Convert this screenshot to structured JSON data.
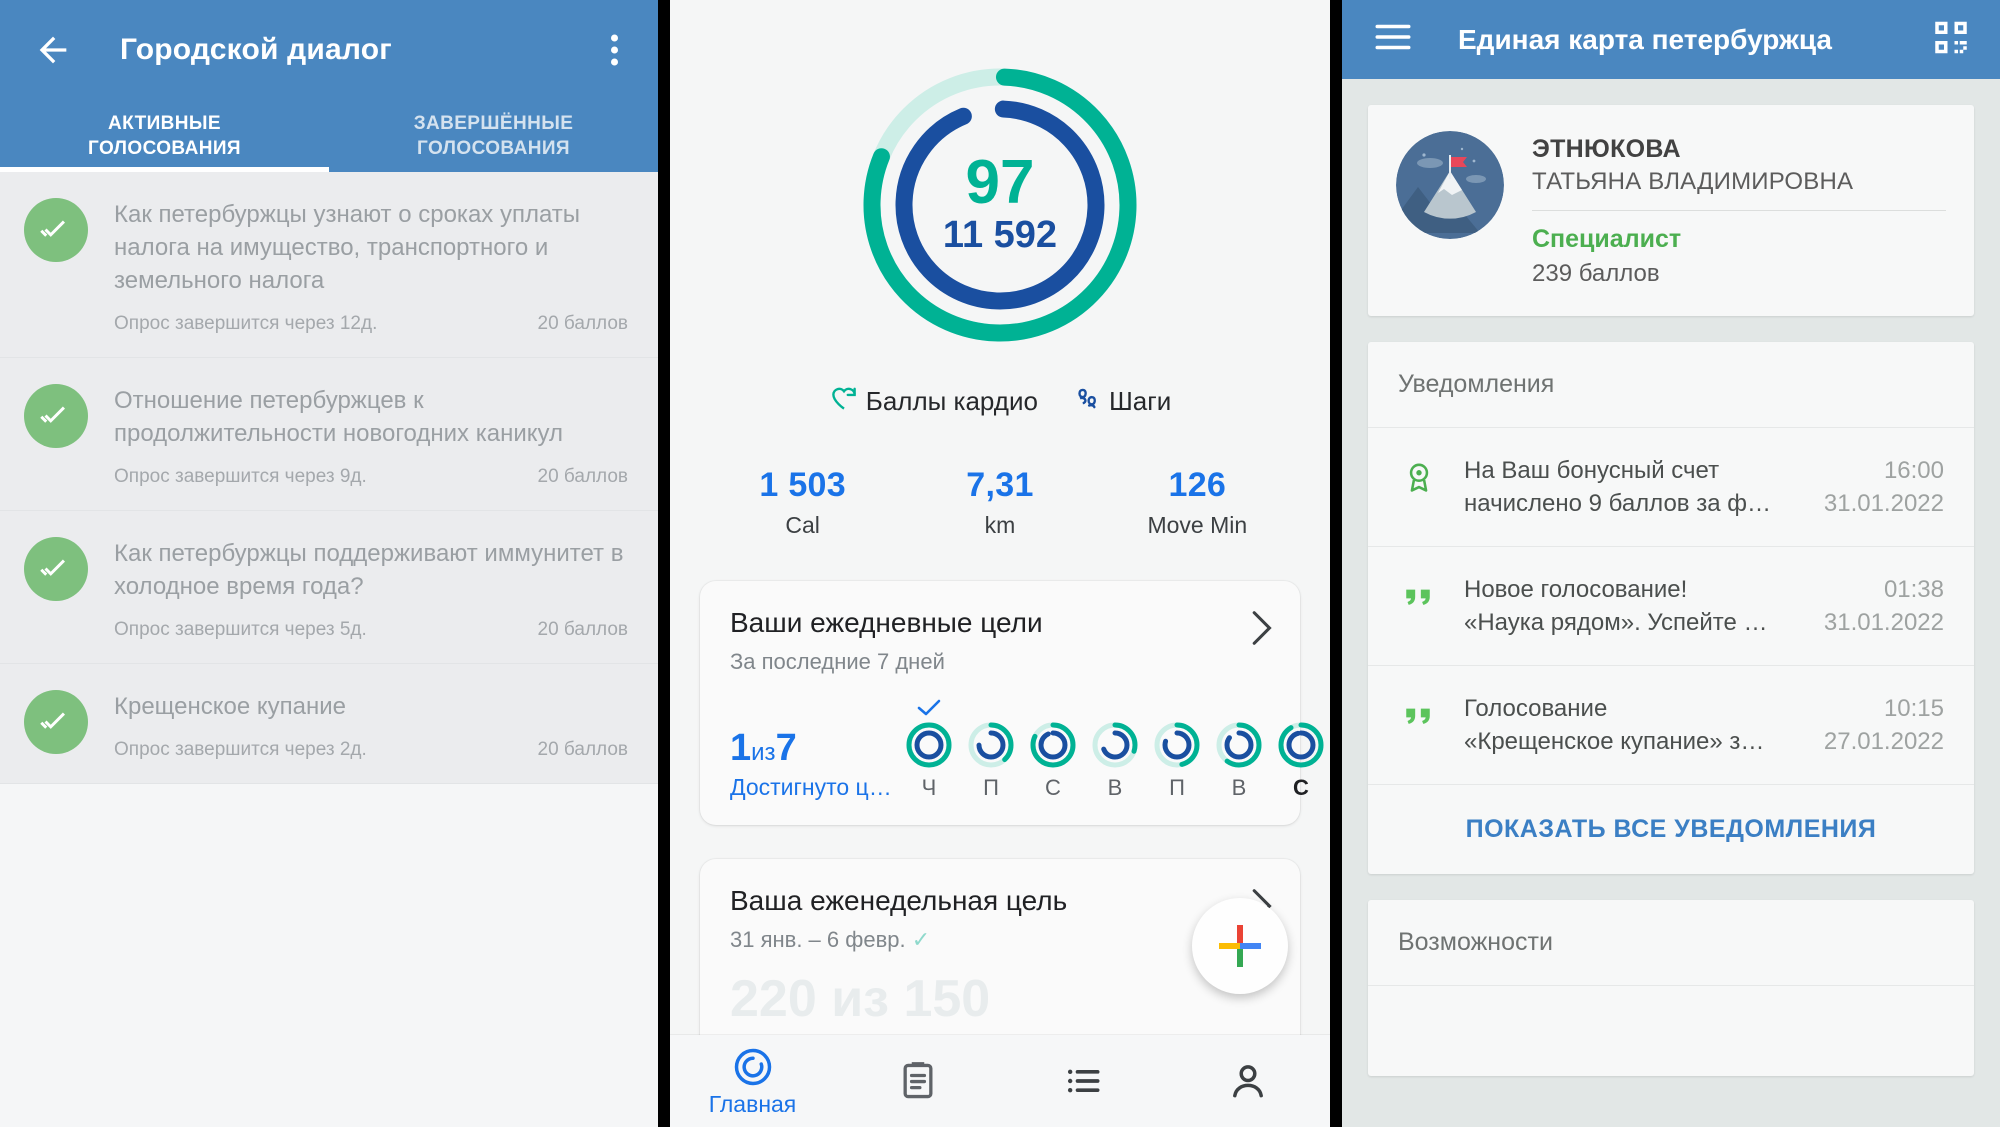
{
  "votes_app": {
    "appbar": {
      "title": "Городской диалог",
      "back_icon": "back-arrow-icon",
      "menu_icon": "kebab-menu-icon"
    },
    "tabs": [
      {
        "line1": "АКТИВНЫЕ",
        "line2": "ГОЛОСОВАНИЯ",
        "active": true
      },
      {
        "line1": "ЗАВЕРШЁННЫЕ",
        "line2": "ГОЛОСОВАНИЯ",
        "active": false
      }
    ],
    "items": [
      {
        "question": "Как петербуржцы узнают о сроках уплаты налога на имущество, транспортного и земельного налога",
        "deadline": "Опрос завершится через 12д.",
        "points": "20 баллов",
        "icon": "double-check-icon"
      },
      {
        "question": "Отношение петербуржцев к продолжительности новогодних каникул",
        "deadline": "Опрос завершится через 9д.",
        "points": "20 баллов",
        "icon": "double-check-icon"
      },
      {
        "question": "Как петербуржцы поддерживают иммунитет в холодное время года?",
        "deadline": "Опрос завершится через 5д.",
        "points": "20 баллов",
        "icon": "double-check-icon"
      },
      {
        "question": "Крещенское купание",
        "deadline": "Опрос завершится через 2д.",
        "points": "20 баллов",
        "icon": "double-check-icon"
      }
    ],
    "colors": {
      "appbar": "#4a87c0",
      "check_circle": "#7ec07e",
      "list_bg": "#ebecee"
    }
  },
  "fit_app": {
    "rings": {
      "heart_points_value": "97",
      "steps_value": "11 592",
      "heart_points_color": "#00b294",
      "steps_color": "#1a4fa0"
    },
    "legend": [
      {
        "label": "Баллы кардио",
        "icon": "heart-points-icon",
        "color": "#00b294"
      },
      {
        "label": "Шаги",
        "icon": "steps-icon",
        "color": "#1a4fa0"
      }
    ],
    "stats": [
      {
        "value": "1 503",
        "label": "Cal"
      },
      {
        "value": "7,31",
        "label": "km"
      },
      {
        "value": "126",
        "label": "Move Min"
      }
    ],
    "daily_card": {
      "title": "Ваши ежедневные цели",
      "subtitle": "За последние 7 дней",
      "count_num": "1",
      "count_mid": "из",
      "count_total": "7",
      "count_label": "Достигнуто ц…",
      "chevron": "chevron-right-icon",
      "days": [
        {
          "label": "Ч",
          "achieved": true,
          "ring_pct": 100,
          "bold": false
        },
        {
          "label": "П",
          "achieved": false,
          "ring_pct": 38,
          "bold": false
        },
        {
          "label": "С",
          "achieved": false,
          "ring_pct": 82,
          "bold": false
        },
        {
          "label": "В",
          "achieved": false,
          "ring_pct": 30,
          "bold": false
        },
        {
          "label": "П",
          "achieved": false,
          "ring_pct": 46,
          "bold": false
        },
        {
          "label": "В",
          "achieved": false,
          "ring_pct": 60,
          "bold": false
        },
        {
          "label": "С",
          "achieved": false,
          "ring_pct": 92,
          "bold": true
        }
      ]
    },
    "weekly_card": {
      "title": "Ваша еженедельная цель",
      "range": "31 янв. – 6 февр.",
      "progress": "220 из 150",
      "chevron": "chevron-right-icon"
    },
    "fab": {
      "icon": "google-plus-add-icon"
    },
    "bottom_nav": [
      {
        "label": "Главная",
        "icon": "activity-ring-icon",
        "active": true
      },
      {
        "label": "",
        "icon": "journal-icon",
        "active": false
      },
      {
        "label": "",
        "icon": "list-icon",
        "active": false
      },
      {
        "label": "",
        "icon": "profile-icon",
        "active": false
      }
    ],
    "colors": {
      "accent_blue": "#1a73e8",
      "teal": "#00b294",
      "navy": "#1a4fa0"
    }
  },
  "ekp_app": {
    "appbar": {
      "title": "Единая карта петербуржца",
      "menu_icon": "hamburger-menu-icon",
      "qr_icon": "qr-code-icon"
    },
    "profile": {
      "surname": "ЭТНЮКОВА",
      "given_name": "ТАТЬЯНА ВЛАДИМИРОВНА",
      "rank": "Специалист",
      "points": "239 баллов",
      "avatar_icon": "mountain-flag-avatar"
    },
    "notifications_header": "Уведомления",
    "notifications": [
      {
        "line1": "На Ваш бонусный счет",
        "line2": "начислено 9 баллов за ф…",
        "time": "16:00",
        "date": "31.01.2022",
        "icon": "award-badge-icon"
      },
      {
        "line1": "Новое голосование!",
        "line2": "«Наука рядом». Успейте …",
        "time": "01:38",
        "date": "31.01.2022",
        "icon": "quote-vote-icon"
      },
      {
        "line1": "Голосование",
        "line2": "«Крещенское купание» з…",
        "time": "10:15",
        "date": "27.01.2022",
        "icon": "quote-vote-icon"
      }
    ],
    "show_all_label": "ПОКАЗАТЬ ВСЕ УВЕДОМЛЕНИЯ",
    "features_header": "Возможности",
    "colors": {
      "appbar": "#4a87c0",
      "rank_green": "#4caf50",
      "link_blue": "#3b7fc4"
    }
  }
}
